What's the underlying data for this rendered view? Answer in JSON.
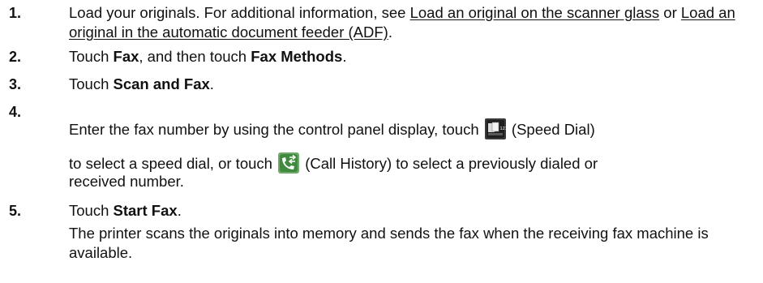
{
  "steps": [
    {
      "number": "1.",
      "text_before": "Load your originals. For additional information, see ",
      "link1": "Load an original on the scanner glass",
      "text_middle": " or ",
      "link2": "Load an original in the automatic document feeder (ADF)",
      "text_after": "."
    },
    {
      "number": "2.",
      "text_a": "Touch ",
      "bold_a": "Fax",
      "text_b": ", and then touch ",
      "bold_b": "Fax Methods",
      "text_c": "."
    },
    {
      "number": "3.",
      "text_a": "Touch ",
      "bold_a": "Scan and Fax",
      "text_b": "."
    },
    {
      "number": "4.",
      "text_a": "Enter the fax number by using the control panel display, touch ",
      "icon1": "speed-dial-icon",
      "text_b": " (Speed Dial)",
      "text_c": "to select a speed dial, or touch ",
      "icon2": "call-history-icon",
      "text_d": " (Call History) to select a previously dialed or",
      "text_e": "received number."
    },
    {
      "number": "5.",
      "text_a": "Touch ",
      "bold_a": "Start Fax",
      "text_b": ".",
      "para": "The printer scans the originals into memory and sends the fax when the receiving fax machine is available."
    }
  ]
}
